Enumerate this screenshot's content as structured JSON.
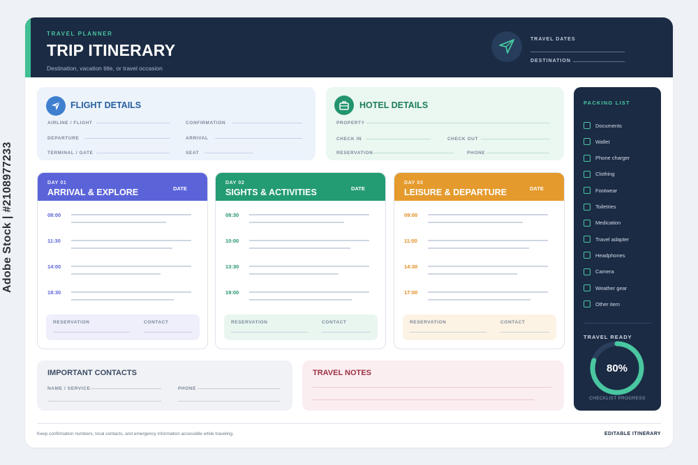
{
  "header": {
    "eyebrow": "TRAVEL PLANNER",
    "title": "TRIP ITINERARY",
    "subtitle": "Destination, vacation title, or travel occasion",
    "travel_dates_label": "TRAVEL DATES",
    "destination_label": "DESTINATION"
  },
  "flight": {
    "title": "FLIGHT DETAILS",
    "fields": {
      "airline": "AIRLINE / FLIGHT",
      "confirmation": "CONFIRMATION",
      "departure": "DEPARTURE",
      "arrival": "ARRIVAL",
      "terminal": "TERMINAL / GATE",
      "seat": "SEAT"
    }
  },
  "hotel": {
    "title": "HOTEL DETAILS",
    "fields": {
      "property": "PROPERTY",
      "check_in": "CHECK IN",
      "check_out": "CHECK OUT",
      "reservation": "RESERVATION",
      "phone": "PHONE"
    }
  },
  "days": [
    {
      "day": "DAY 01",
      "title": "ARRIVAL & EXPLORE",
      "date_label": "DATE",
      "times": [
        "08:00",
        "11:30",
        "14:00",
        "18:30"
      ],
      "reservation_label": "RESERVATION",
      "contact_label": "CONTACT"
    },
    {
      "day": "DAY 02",
      "title": "SIGHTS & ACTIVITIES",
      "date_label": "DATE",
      "times": [
        "08:30",
        "10:00",
        "13:30",
        "19:00"
      ],
      "reservation_label": "RESERVATION",
      "contact_label": "CONTACT"
    },
    {
      "day": "DAY 03",
      "title": "LEISURE & DEPARTURE",
      "date_label": "DATE",
      "times": [
        "09:00",
        "11:00",
        "14:30",
        "17:00"
      ],
      "reservation_label": "RESERVATION",
      "contact_label": "CONTACT"
    }
  ],
  "contacts": {
    "title": "IMPORTANT CONTACTS",
    "name_label": "NAME / SERVICE",
    "phone_label": "PHONE"
  },
  "notes": {
    "title": "TRAVEL NOTES"
  },
  "packing": {
    "title": "PACKING LIST",
    "items": [
      "Documents",
      "Wallet",
      "Phone charger",
      "Clothing",
      "Footwear",
      "Toiletries",
      "Medication",
      "Travel adapter",
      "Headphones",
      "Camera",
      "Weather gear",
      "Other item"
    ],
    "ready_title": "TRAVEL READY",
    "ready_value": "80%",
    "ready_fraction": 0.8,
    "ready_caption": "CHECKLIST PROGRESS"
  },
  "footer": {
    "note": "Keep confirmation numbers, local contacts, and emergency information accessible while traveling.",
    "right": "EDITABLE ITINERARY"
  },
  "watermark": "Adobe Stock | #2108977233",
  "colors": {
    "navy": "#1b2b44",
    "teal": "#49c7a0",
    "day1": "#5b63d9",
    "day2": "#239b73",
    "day3": "#e59a2d",
    "flight_bg": "#edf3fb",
    "hotel_bg": "#ebf7f1",
    "notes_title": "#9c3042"
  }
}
